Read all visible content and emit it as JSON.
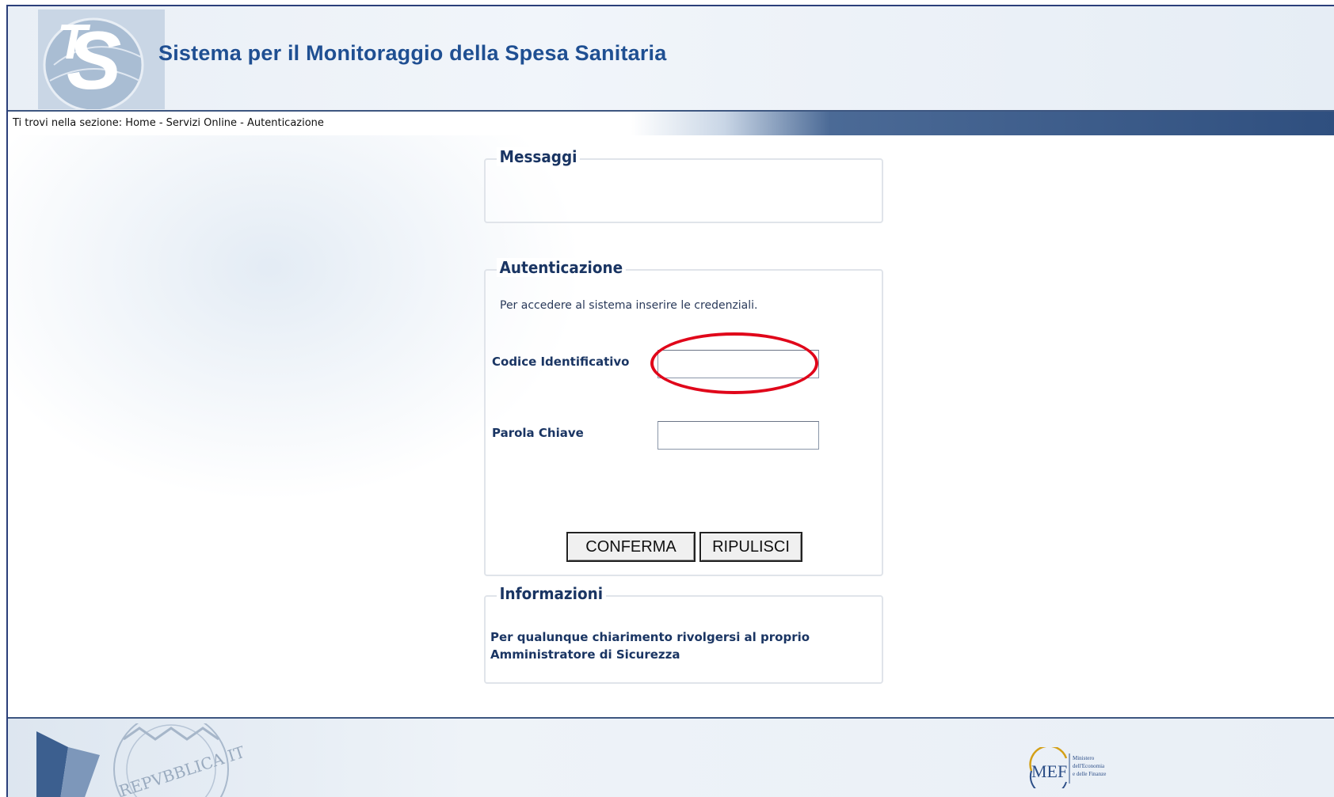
{
  "header": {
    "logo_text": "TS",
    "title": "Sistema per il Monitoraggio della Spesa Sanitaria"
  },
  "breadcrumb": {
    "text": "Ti trovi nella sezione: Home - Servizi Online - Autenticazione"
  },
  "messaggi": {
    "legend": "Messaggi"
  },
  "autenticazione": {
    "legend": "Autenticazione",
    "intro": "Per accedere al sistema inserire le credenziali.",
    "codice_label": "Codice Identificativo",
    "codice_value": "",
    "parola_label": "Parola Chiave",
    "parola_value": "",
    "confirm_label": "CONFERMA",
    "reset_label": "RIPULISCI",
    "highlight_color": "#e0061a"
  },
  "informazioni": {
    "legend": "Informazioni",
    "text": "Per qualunque chiarimento rivolgersi al proprio Amministratore di Sicurezza"
  },
  "footer": {
    "emblem_text": "REPVBBLICA ITALIANA",
    "mef_abbr": "MEF",
    "mef_lines": [
      "Ministero",
      "dell'Economia",
      "e delle Finanze"
    ]
  },
  "colors": {
    "brand_blue": "#1f4f92",
    "frame_border": "#2b3f7a",
    "label_navy": "#1a3563"
  }
}
